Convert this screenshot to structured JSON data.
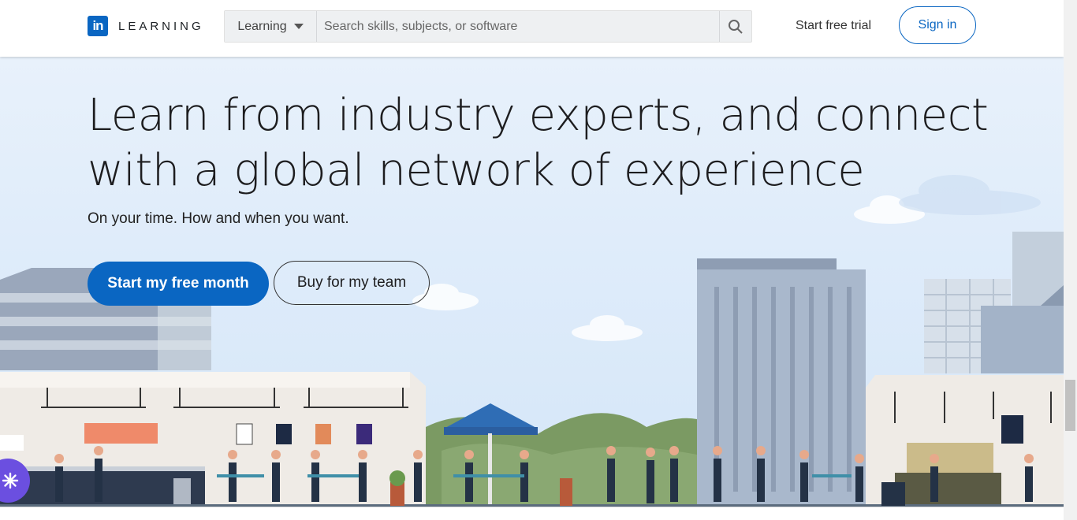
{
  "header": {
    "logo_mark": "in",
    "logo_word": "LEARNING",
    "search_type": "Learning",
    "search_placeholder": "Search skills, subjects, or software",
    "start_trial": "Start free trial",
    "sign_in": "Sign in"
  },
  "hero": {
    "headline": "Learn from industry experts, and connect with a global network of experience",
    "subheadline": "On your time. How and when you want.",
    "primary_cta": "Start my free month",
    "secondary_cta": "Buy for my team"
  },
  "colors": {
    "brand": "#0a66c2",
    "chat_button": "#6b4fe0"
  },
  "icons": {
    "search": "search-icon",
    "dropdown": "caret-down-icon",
    "chat": "sparkle-icon"
  }
}
